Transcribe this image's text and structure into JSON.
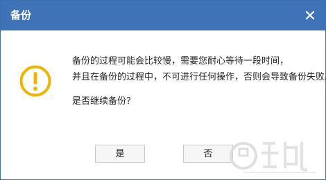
{
  "dialog": {
    "title": "备份",
    "close_icon": "close-icon",
    "warning_icon": "warning-exclamation-icon",
    "message_line1": "备份的过程可能会比较慢，需要您耐心等待一段时间，",
    "message_line2": "并且在备份的过程中，不可进行任何操作，否则会导致备份失败。",
    "question": "是否继续备份？",
    "yes_label": "是",
    "no_label": "否"
  },
  "colors": {
    "titlebar": "#3f73b8",
    "warning": "#f0b400",
    "text": "#222222"
  }
}
